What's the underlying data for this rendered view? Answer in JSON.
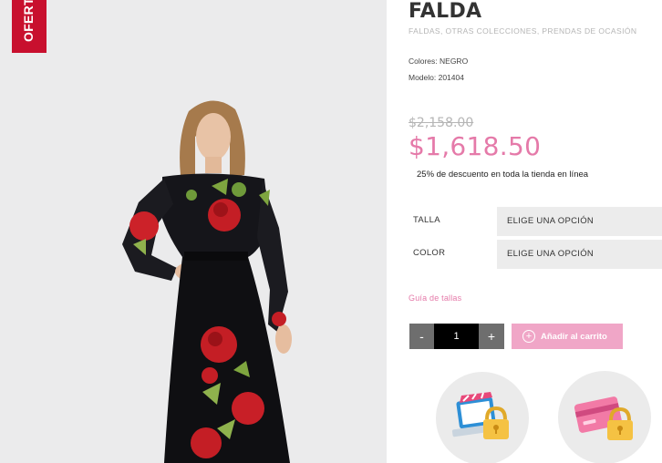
{
  "ribbon": {
    "label": "OFERTA"
  },
  "product": {
    "title": "FALDA",
    "categories": "FALDAS, OTRAS COLECCIONES, PRENDAS DE OCASIÓN",
    "colors": "Colores: NEGRO",
    "model": "Modelo: 201404",
    "old_price": "$2,158.00",
    "new_price": "$1,618.50",
    "discount_note": "25% de descuento en toda la tienda en línea"
  },
  "options": {
    "size": {
      "label": "TALLA",
      "value": "ELIGE UNA OPCIÓN"
    },
    "color": {
      "label": "COLOR",
      "value": "ELIGE UNA OPCIÓN"
    }
  },
  "size_guide": "Guía de tallas",
  "cart": {
    "minus": "-",
    "quantity": "1",
    "plus": "+",
    "add_label": "Añadir al carrito"
  },
  "icons": {
    "shop": "online-shop-lock-icon",
    "card": "secure-card-lock-icon"
  },
  "colors": {
    "accent_pink": "#e57aa9",
    "button_pink": "#f0a6c7",
    "ribbon_red": "#c8102e"
  }
}
